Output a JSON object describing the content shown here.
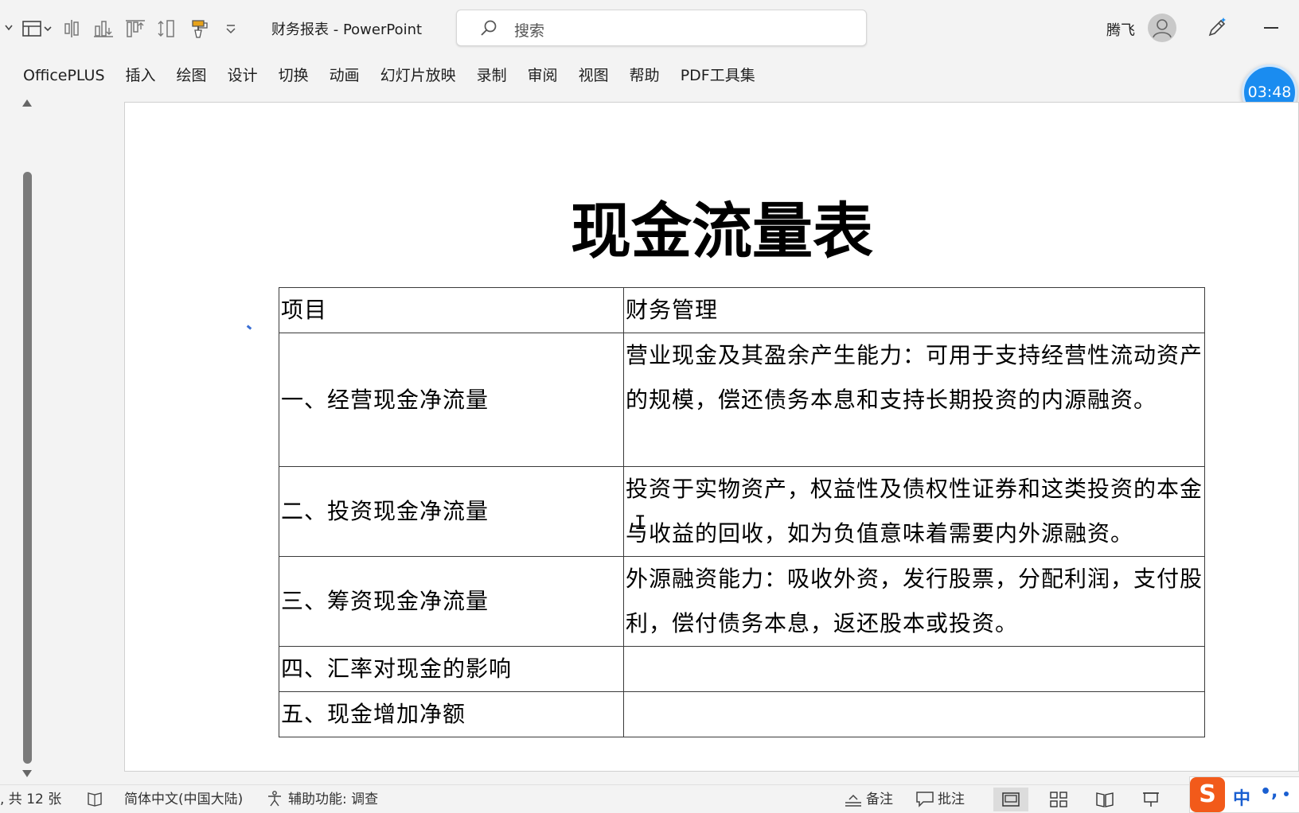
{
  "window": {
    "doc_title": "财务报表 - PowerPoint",
    "search_placeholder": "搜索",
    "user_name": "腾飞"
  },
  "ribbon": {
    "tabs": [
      "OfficePLUS",
      "插入",
      "绘图",
      "设计",
      "切换",
      "动画",
      "幻灯片放映",
      "录制",
      "审阅",
      "视图",
      "帮助",
      "PDF工具集"
    ]
  },
  "timer": "03:48",
  "slide": {
    "title": "现金流量表",
    "table": {
      "headers": [
        "项目",
        "财务管理"
      ],
      "rows": [
        {
          "item": "一、经营现金净流量",
          "desc": "营业现金及其盈余产生能力：可用于支持经营性流动资产的规模，偿还债务本息和支持长期投资的内源融资。"
        },
        {
          "item": "二、投资现金净流量",
          "desc": "投资于实物资产，权益性及债权性证券和这类投资的本金与收益的回收，如为负值意味着需要内外源融资。"
        },
        {
          "item": "三、筹资现金净流量",
          "desc": "外源融资能力：吸收外资，发行股票，分配利润，支付股利，偿付债务本息，返还股本或投资。"
        },
        {
          "item": "四、汇率对现金的影响",
          "desc": ""
        },
        {
          "item": "五、现金增加净额",
          "desc": ""
        }
      ]
    }
  },
  "statusbar": {
    "slide_count": ", 共 12 张",
    "language": "简体中文(中国大陆)",
    "accessibility": "辅助功能: 调查",
    "notes": "备注",
    "comments": "批注"
  },
  "ime": {
    "logo": "S",
    "mode": "中",
    "punct": "•,"
  },
  "colors": {
    "timer_blue": "#1a8cf0",
    "ime_orange": "#f25a1a",
    "ime_blue": "#1a5fd1"
  }
}
